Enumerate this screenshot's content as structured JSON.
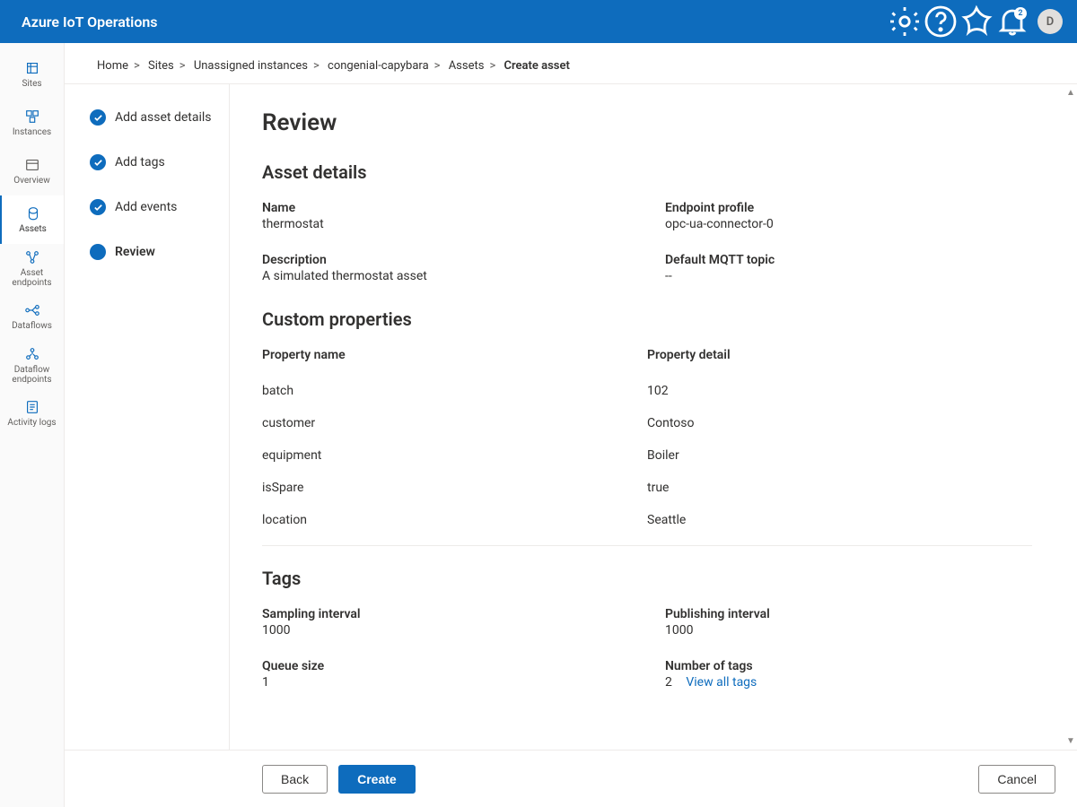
{
  "app": {
    "title": "Azure IoT Operations",
    "notifications_badge": "2",
    "avatar_initial": "D"
  },
  "leftnav": {
    "items": [
      {
        "label": "Sites"
      },
      {
        "label": "Instances"
      },
      {
        "label": "Overview"
      },
      {
        "label": "Assets"
      },
      {
        "label": "Asset endpoints"
      },
      {
        "label": "Dataflows"
      },
      {
        "label": "Dataflow endpoints"
      },
      {
        "label": "Activity logs"
      }
    ]
  },
  "breadcrumb": {
    "items": [
      "Home",
      "Sites",
      "Unassigned instances",
      "congenial-capybara",
      "Assets"
    ],
    "current": "Create asset"
  },
  "wizard": {
    "steps": [
      "Add asset details",
      "Add tags",
      "Add events",
      "Review"
    ]
  },
  "review": {
    "title": "Review",
    "asset_details": {
      "heading": "Asset details",
      "name": {
        "label": "Name",
        "value": "thermostat"
      },
      "endpoint_profile": {
        "label": "Endpoint profile",
        "value": "opc-ua-connector-0"
      },
      "description": {
        "label": "Description",
        "value": "A simulated thermostat asset"
      },
      "mqtt_topic": {
        "label": "Default MQTT topic",
        "value": "--"
      }
    },
    "custom_properties": {
      "heading": "Custom properties",
      "col_name": "Property name",
      "col_detail": "Property detail",
      "rows": [
        {
          "name": "batch",
          "detail": "102"
        },
        {
          "name": "customer",
          "detail": "Contoso"
        },
        {
          "name": "equipment",
          "detail": "Boiler"
        },
        {
          "name": "isSpare",
          "detail": "true"
        },
        {
          "name": "location",
          "detail": "Seattle"
        }
      ]
    },
    "tags": {
      "heading": "Tags",
      "sampling_interval": {
        "label": "Sampling interval",
        "value": "1000"
      },
      "publishing_interval": {
        "label": "Publishing interval",
        "value": "1000"
      },
      "queue_size": {
        "label": "Queue size",
        "value": "1"
      },
      "num_tags": {
        "label": "Number of tags",
        "value": "2",
        "link": "View all tags"
      }
    }
  },
  "footer": {
    "back": "Back",
    "create": "Create",
    "cancel": "Cancel"
  }
}
